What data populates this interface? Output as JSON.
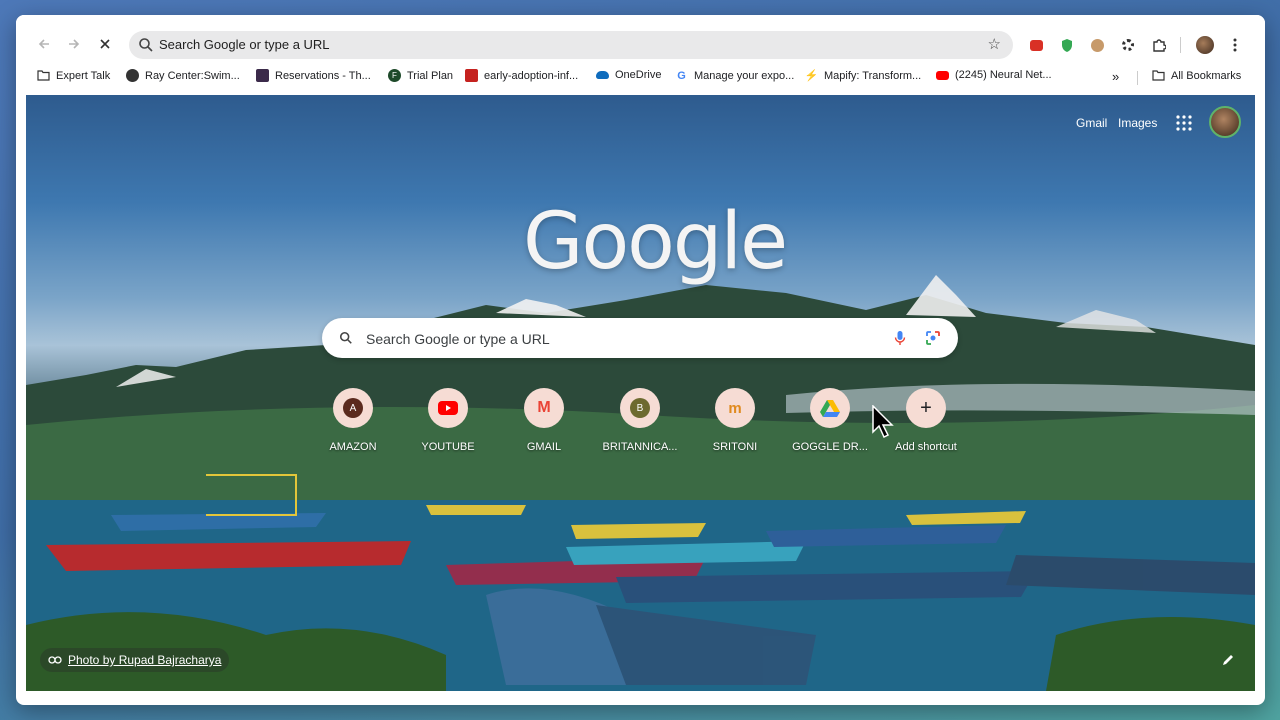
{
  "toolbar": {
    "back_icon": "arrow-left-icon",
    "forward_icon": "arrow-right-icon",
    "stop_icon": "close-icon",
    "omnibox_text": "Search Google or type a URL",
    "extensions": [
      "red-extension-icon",
      "shield-extension-icon",
      "face-extension-icon",
      "gear-icon",
      "puzzle-icon",
      "avatar-icon",
      "menu-icon"
    ]
  },
  "bookmarks": {
    "items": [
      {
        "label": "Expert Talk",
        "icon": "folder-icon"
      },
      {
        "label": "Ray Center:Swim...",
        "icon": "globe-icon"
      },
      {
        "label": "Reservations - Th...",
        "icon": "app-icon"
      },
      {
        "label": "Trial Plan",
        "icon": "fit-icon"
      },
      {
        "label": "early-adoption-inf...",
        "icon": "pdf-icon"
      },
      {
        "label": "OneDrive",
        "icon": "cloud-icon"
      },
      {
        "label": "Manage your expo...",
        "icon": "google-icon"
      },
      {
        "label": "Mapify: Transform...",
        "icon": "mapify-icon"
      },
      {
        "label": "(2245) Neural Net...",
        "icon": "youtube-icon"
      }
    ],
    "overflow_label": "»",
    "all_bookmarks": "All Bookmarks"
  },
  "ntp": {
    "gmail_link": "Gmail",
    "images_link": "Images",
    "logo_text": "Google",
    "search_placeholder": "Search Google or type a URL",
    "shortcuts": [
      {
        "label": "AMAZON",
        "letter": "A",
        "color": "#5b2a1e"
      },
      {
        "label": "YOUTUBE",
        "letter": "",
        "color": "#ff0000"
      },
      {
        "label": "GMAIL",
        "letter": "M",
        "color": "#ea4335"
      },
      {
        "label": "BRITANNICA...",
        "letter": "B",
        "color": "#6d6a2f"
      },
      {
        "label": "SRITONI",
        "letter": "m",
        "color": "#e08a1e"
      },
      {
        "label": "GOGGLE DR...",
        "letter": "",
        "color": "#34a853"
      },
      {
        "label": "Add shortcut",
        "letter": "+",
        "color": "#202124"
      }
    ],
    "photo_credit": "Photo by Rupad Bajracharya"
  },
  "colors": {
    "accent": "#1a73e8",
    "omnibox_bg": "#e9e9ea",
    "shortcut_bg": "#f6dcd4"
  }
}
